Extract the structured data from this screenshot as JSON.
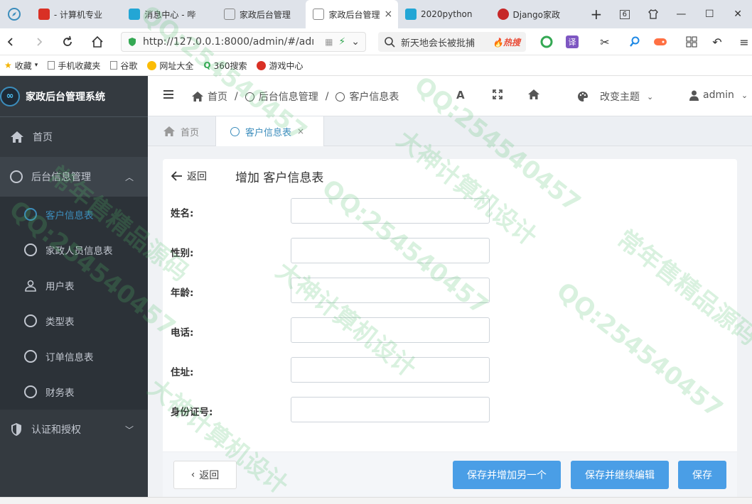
{
  "browser": {
    "tabs": [
      {
        "label": "- 计算机专业",
        "color": "#d93025"
      },
      {
        "label": "消息中心 - 哔",
        "color": "#23a6d5"
      },
      {
        "label": "家政后台管理",
        "color": "#888888"
      },
      {
        "label": "家政后台管理",
        "color": "#888888",
        "active": true
      },
      {
        "label": "2020python",
        "color": "#23a6d5"
      },
      {
        "label": "Django家政",
        "color": "#c62828"
      }
    ],
    "tab_counter": "6",
    "url": "http://127.0.0.1:8000/admin/#/adı",
    "search_text": "新天地会长被批捕",
    "hot_label": "热搜",
    "translate_label": "译"
  },
  "bookmarks": [
    {
      "label": "收藏",
      "icon": "star-icon"
    },
    {
      "label": "手机收藏夹",
      "icon": "page-icon"
    },
    {
      "label": "谷歌",
      "icon": "page-icon"
    },
    {
      "label": "网址大全",
      "icon": "globe-icon"
    },
    {
      "label": "360搜索",
      "icon": "search-icon"
    },
    {
      "label": "游戏中心",
      "icon": "game-icon"
    }
  ],
  "sidebar": {
    "brand": "家政后台管理系统",
    "brand_logo": "∞",
    "home": "首页",
    "group": "后台信息管理",
    "items": [
      {
        "label": "客户信息表",
        "icon": "circle-icon",
        "active": true
      },
      {
        "label": "家政人员信息表",
        "icon": "circle-icon"
      },
      {
        "label": "用户表",
        "icon": "user-icon"
      },
      {
        "label": "类型表",
        "icon": "circle-icon"
      },
      {
        "label": "订单信息表",
        "icon": "circle-icon"
      },
      {
        "label": "财务表",
        "icon": "circle-icon"
      }
    ],
    "auth": "认证和授权"
  },
  "header": {
    "breadcrumb_home": "首页",
    "breadcrumb_group": "后台信息管理",
    "breadcrumb_current": "客户信息表",
    "font_icon_text": "A",
    "theme_label": "改变主题",
    "user": "admin"
  },
  "page_tabs": {
    "home": "首页",
    "current": "客户信息表"
  },
  "form": {
    "back": "返回",
    "title": "增加 客户信息表",
    "fields": [
      {
        "label": "姓名:",
        "value": ""
      },
      {
        "label": "性别:",
        "value": ""
      },
      {
        "label": "年龄:",
        "value": ""
      },
      {
        "label": "电话:",
        "value": ""
      },
      {
        "label": "住址:",
        "value": ""
      },
      {
        "label": "身份证号:",
        "value": ""
      }
    ],
    "footer": {
      "back": "返回",
      "save_add": "保存并增加另一个",
      "save_continue": "保存并继续编辑",
      "save": "保存"
    }
  },
  "watermarks": [
    "QQ:254540457",
    "大神计算机设计",
    "常年售精品源码"
  ],
  "colors": {
    "sidebar_bg": "#343a40",
    "accent": "#3c8dbc",
    "primary_button": "#4a9ee6"
  }
}
